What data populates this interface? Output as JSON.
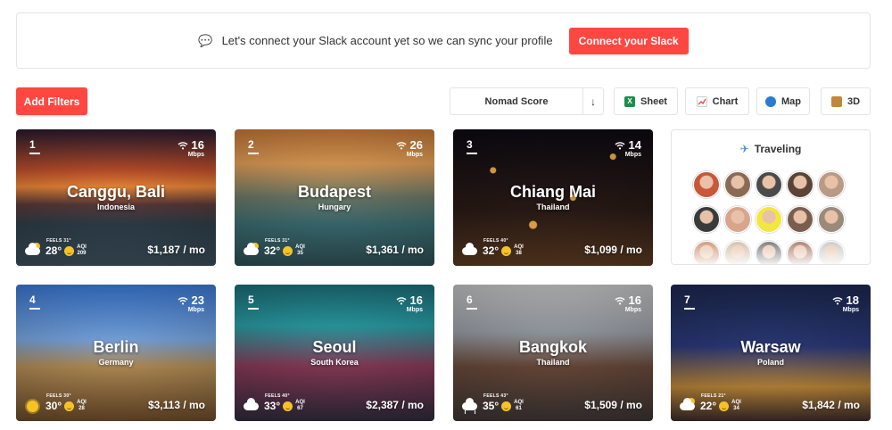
{
  "banner": {
    "icon": "chat-bubble-icon",
    "message": "Let's connect your Slack account yet so we can sync your profile",
    "button_label": "Connect your Slack"
  },
  "toolbar": {
    "add_filters_label": "Add Filters",
    "sort_label": "Nomad Score",
    "sort_direction_icon": "arrow-down-icon",
    "views": [
      {
        "label": "Sheet",
        "icon": "excel-icon"
      },
      {
        "label": "Chart",
        "icon": "chart-icon"
      },
      {
        "label": "Map",
        "icon": "globe-icon"
      },
      {
        "label": "3D",
        "icon": "box-icon"
      }
    ]
  },
  "colors": {
    "accent_red": "#ff4742",
    "border": "#e4e4e4"
  },
  "cities": [
    {
      "rank": "1",
      "city": "Canggu, Bali",
      "country": "Indonesia",
      "internet": "16",
      "internet_unit": "Mbps",
      "feels": "FEELS 31°",
      "temp": "28°",
      "aqi_label": "AQI",
      "aqi": "209",
      "price": "$1,187 / mo",
      "weather": "cloud-sun"
    },
    {
      "rank": "2",
      "city": "Budapest",
      "country": "Hungary",
      "internet": "26",
      "internet_unit": "Mbps",
      "feels": "FEELS 31°",
      "temp": "32°",
      "aqi_label": "AQI",
      "aqi": "35",
      "price": "$1,361 / mo",
      "weather": "cloud-sun"
    },
    {
      "rank": "3",
      "city": "Chiang Mai",
      "country": "Thailand",
      "internet": "14",
      "internet_unit": "Mbps",
      "feels": "FEELS 40°",
      "temp": "32°",
      "aqi_label": "AQI",
      "aqi": "38",
      "price": "$1,099 / mo",
      "weather": "cloud"
    },
    {
      "rank": "4",
      "city": "Berlin",
      "country": "Germany",
      "internet": "23",
      "internet_unit": "Mbps",
      "feels": "FEELS 30°",
      "temp": "30°",
      "aqi_label": "AQI",
      "aqi": "28",
      "price": "$3,113 / mo",
      "weather": "sun"
    },
    {
      "rank": "5",
      "city": "Seoul",
      "country": "South Korea",
      "internet": "16",
      "internet_unit": "Mbps",
      "feels": "FEELS 40°",
      "temp": "33°",
      "aqi_label": "AQI",
      "aqi": "67",
      "price": "$2,387 / mo",
      "weather": "cloud"
    },
    {
      "rank": "6",
      "city": "Bangkok",
      "country": "Thailand",
      "internet": "16",
      "internet_unit": "Mbps",
      "feels": "FEELS 43°",
      "temp": "35°",
      "aqi_label": "AQI",
      "aqi": "61",
      "price": "$1,509 / mo",
      "weather": "rain"
    },
    {
      "rank": "7",
      "city": "Warsaw",
      "country": "Poland",
      "internet": "18",
      "internet_unit": "Mbps",
      "feels": "FEELS 21°",
      "temp": "22°",
      "aqi_label": "AQI",
      "aqi": "34",
      "price": "$1,842 / mo",
      "weather": "cloud-sun"
    }
  ],
  "traveling": {
    "title": "Traveling",
    "icon": "airplane-icon",
    "avatar_colors": [
      "#c9573a",
      "#8a6a55",
      "#4a4a4a",
      "#5a4438",
      "#b89a86",
      "#3a3a3a",
      "#d8a58c",
      "#f2e640",
      "#7a5d4e",
      "#9a8a7a",
      "#c98a6a",
      "#d0b7a0",
      "#6a6a6a",
      "#a07060",
      "#c4c4c4"
    ]
  }
}
